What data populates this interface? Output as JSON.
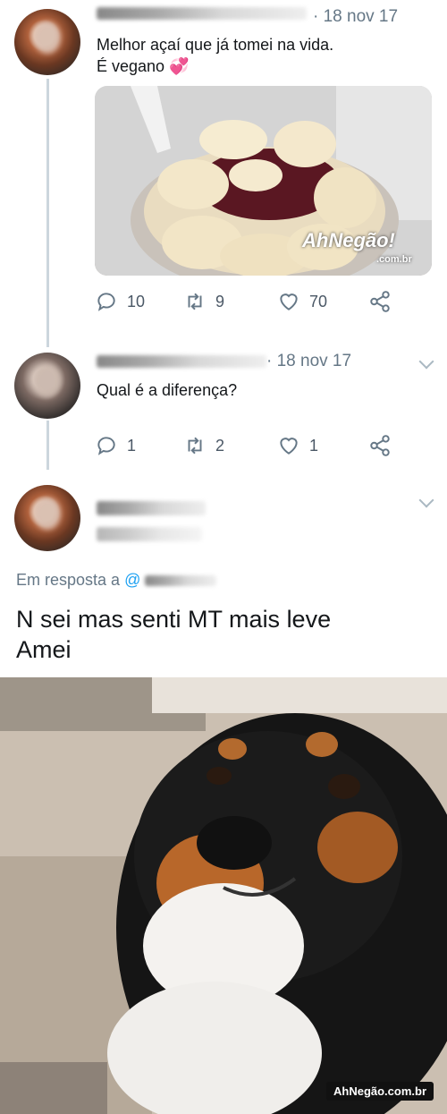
{
  "tweet1": {
    "date": "· 18 nov 17",
    "text_line1": "Melhor açaí que já tomei na vida.",
    "text_line2": "É vegano 💞",
    "image_watermark": "AhNegão!",
    "image_watermark_sub": ".com.br",
    "replies": "10",
    "retweets": "9",
    "likes": "70"
  },
  "tweet2": {
    "date": "18 nov 17",
    "text": "Qual é a diferença?",
    "replies": "1",
    "retweets": "2",
    "likes": "1"
  },
  "tweet3": {
    "reply_to_label": "Em resposta a",
    "reply_to_handle": "@",
    "text_line1": "N sei mas senti MT mais leve",
    "text_line2": "Amei"
  },
  "footer_watermark": "AhNegão.com.br",
  "colors": {
    "text": "#14171a",
    "meta": "#657786",
    "link": "#1da1f2",
    "thread_line": "#ccd6dd"
  },
  "icons": [
    "reply-icon",
    "retweet-icon",
    "like-icon",
    "share-icon",
    "caret-down-icon"
  ]
}
